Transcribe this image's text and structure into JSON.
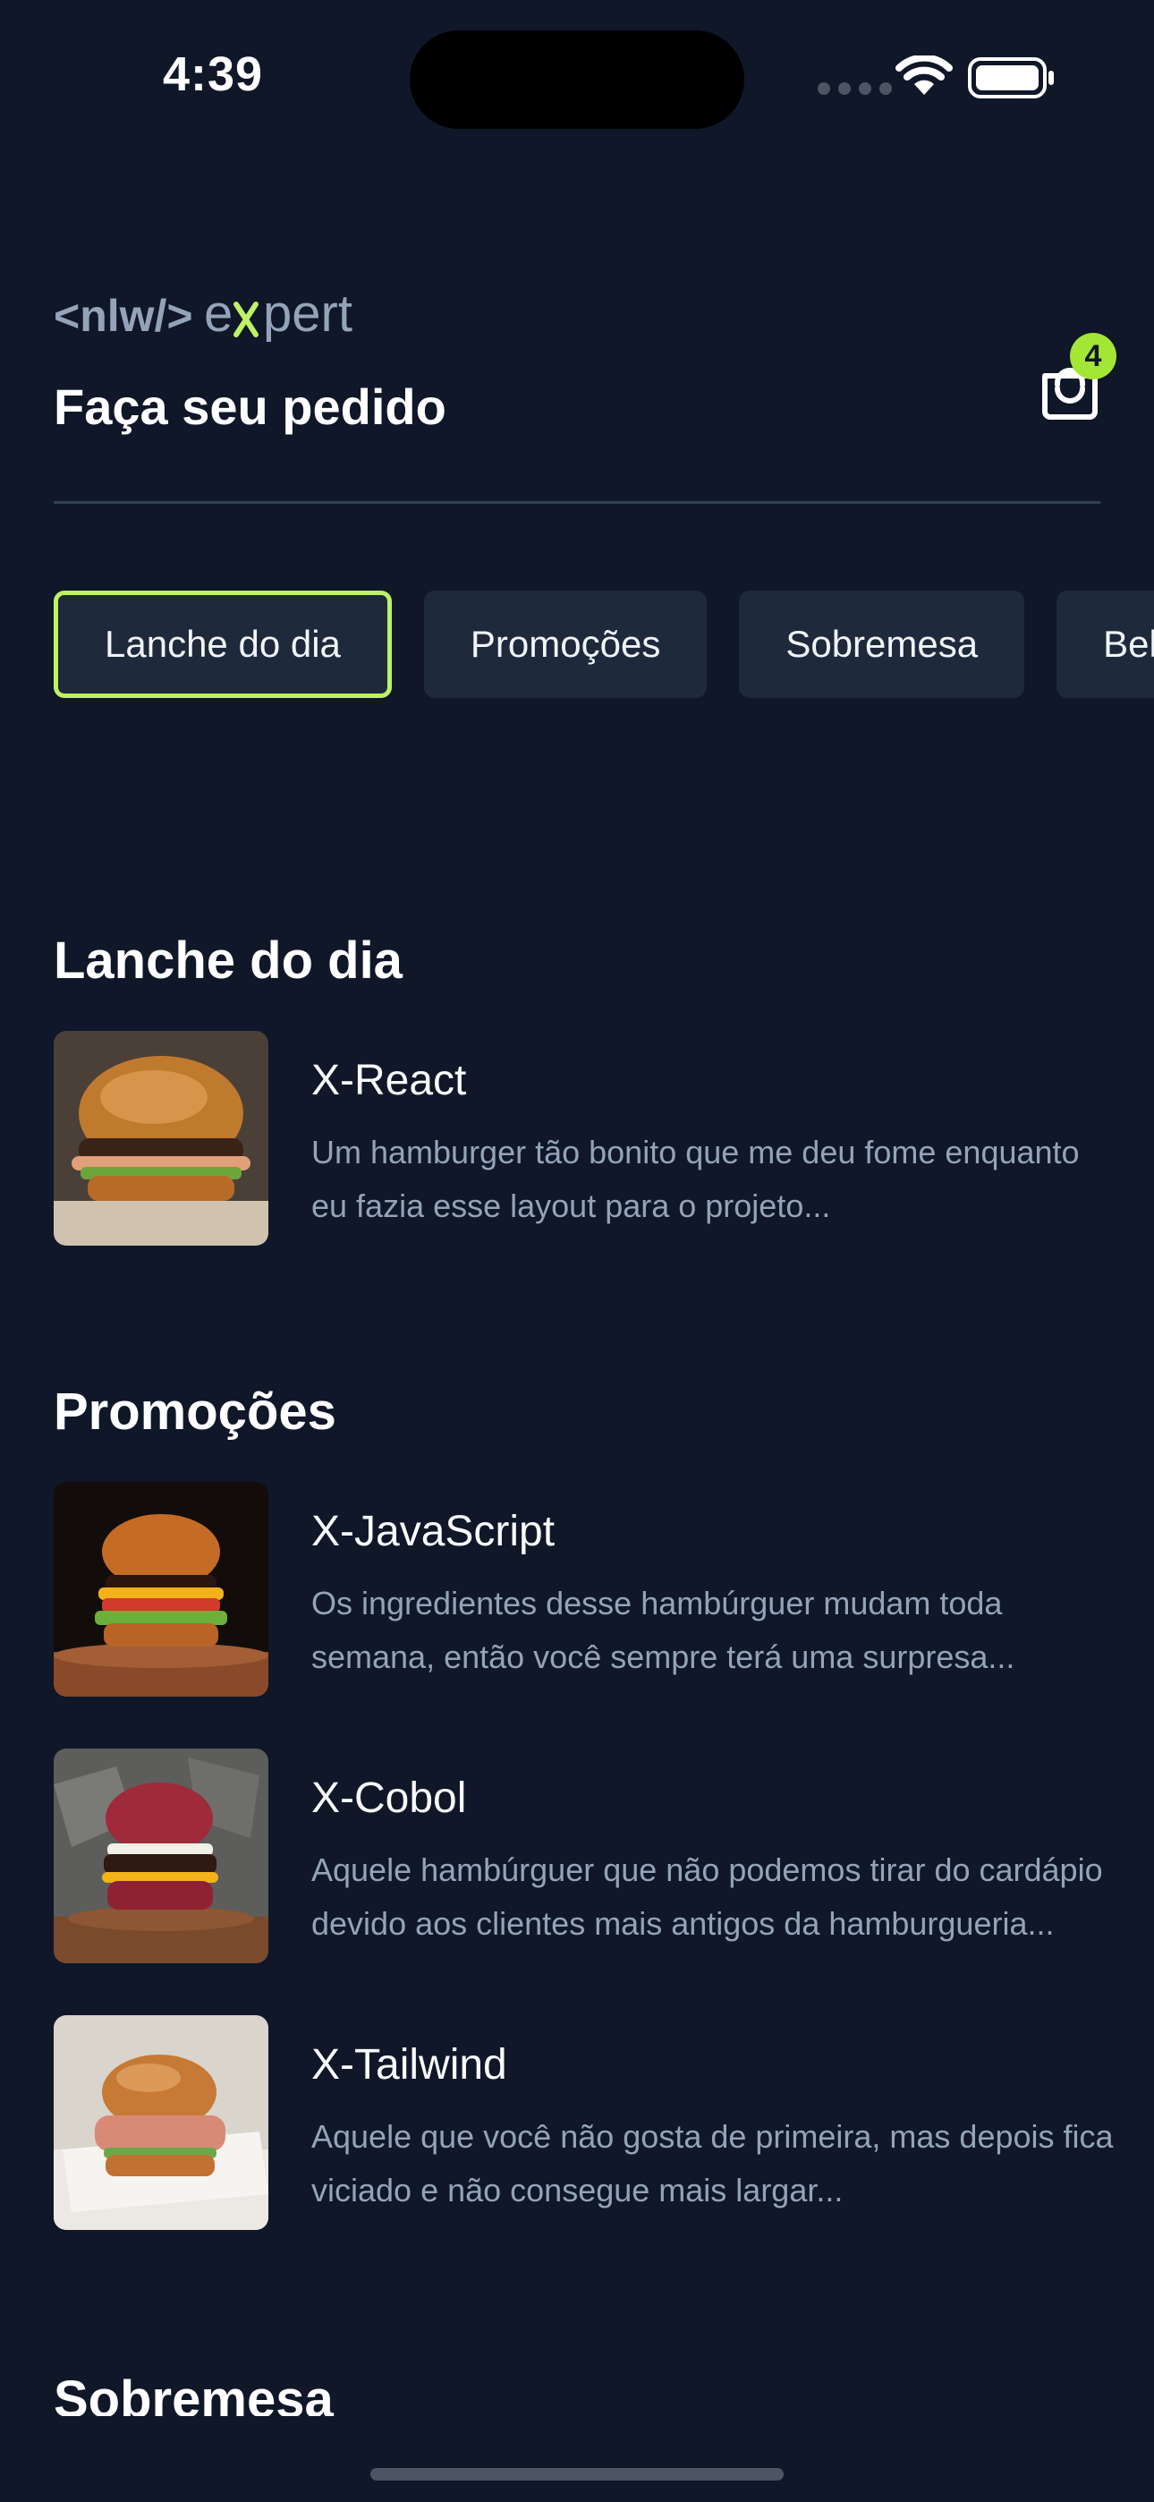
{
  "status_bar": {
    "time": "4:39"
  },
  "header": {
    "logo_text": "<nlw/> expert",
    "title": "Faça seu pedido",
    "cart_count": "4"
  },
  "tabs": [
    {
      "label": "Lanche do dia",
      "active": true
    },
    {
      "label": "Promoções",
      "active": false
    },
    {
      "label": "Sobremesa",
      "active": false
    },
    {
      "label": "Bebidas",
      "active": false
    }
  ],
  "sections": [
    {
      "title": "Lanche do dia",
      "items": [
        {
          "name": "X-React",
          "description": "Um hamburger tão bonito que me deu fome enquanto eu fazia esse layout para o projeto..."
        }
      ]
    },
    {
      "title": "Promoções",
      "items": [
        {
          "name": "X-JavaScript",
          "description": "Os ingredientes desse hambúrguer mudam toda semana, então você sempre terá uma surpresa..."
        },
        {
          "name": "X-Cobol",
          "description": "Aquele hambúrguer que não podemos tirar do cardápio devido aos clientes mais antigos da hamburgueria..."
        },
        {
          "name": "X-Tailwind",
          "description": "Aquele que você não gosta de primeira, mas depois fica viciado e não consegue mais largar..."
        }
      ]
    },
    {
      "title": "Sobremesa",
      "items": []
    }
  ],
  "colors": {
    "background": "#0f1729",
    "accent": "#a3e635",
    "tab_bg": "#1e293b",
    "muted_text": "#94a3b8"
  }
}
